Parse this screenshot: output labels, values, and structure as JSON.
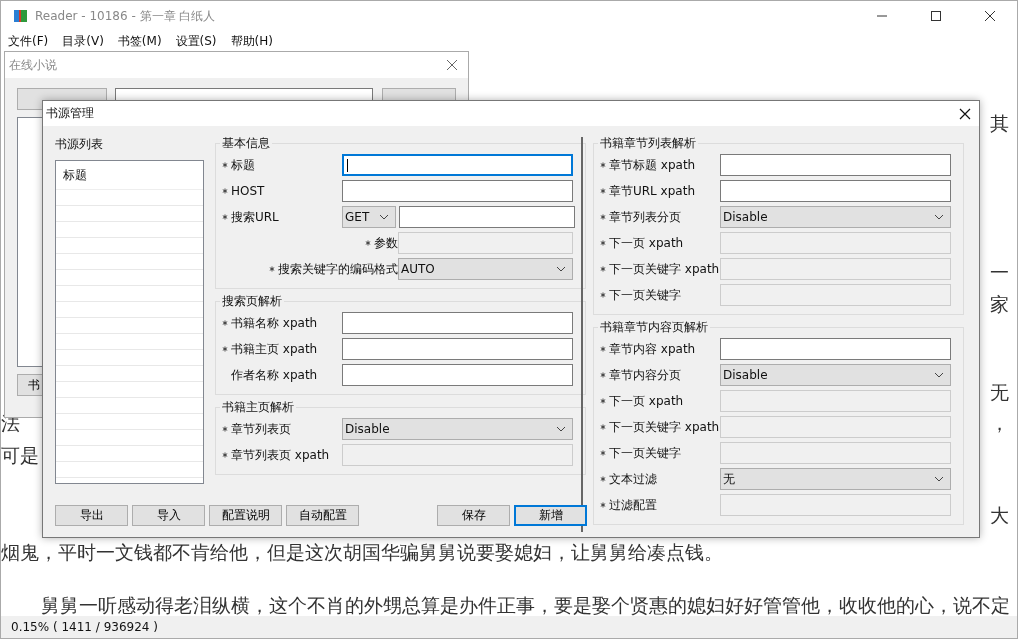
{
  "main_window": {
    "title": "Reader - 10186 - 第一章 白纸人",
    "menu": [
      "文件(F)",
      "目录(V)",
      "书签(M)",
      "设置(S)",
      "帮助(H)"
    ],
    "reader_text": [
      {
        "right": "其"
      },
      {
        "right": "一"
      },
      {
        "right": "家"
      },
      {
        "right": "无"
      },
      {
        "left": "法",
        "right": "，"
      },
      {
        "left": "可是"
      },
      {
        "right": "大"
      },
      {
        "left": "烟鬼，平时一文钱都不肯给他，但是这次胡国华骗舅舅说要娶媳妇，让舅舅给凑点钱。"
      },
      {
        "left": "舅舅一听感动得老泪纵横，这个不肖的外甥总算是办件正事，要是娶个贤惠的媳妇好好管管他，收收他的心，说不定"
      }
    ],
    "status": "0.15%  ( 1411 / 936924 )"
  },
  "online_window": {
    "title": "在线小说",
    "button": "书"
  },
  "dialog": {
    "title": "书源管理",
    "list_label": "书源列表",
    "list_column": "标题",
    "buttons": [
      {
        "label": "导出",
        "default": false
      },
      {
        "label": "导入",
        "default": false
      },
      {
        "label": "配置说明",
        "default": false
      },
      {
        "label": "自动配置",
        "default": false
      },
      {
        "label": "保存",
        "default": false
      },
      {
        "label": "新增",
        "default": true
      }
    ],
    "left_groups": [
      {
        "title": "基本信息",
        "fields": [
          {
            "label": "标题",
            "required": true,
            "kind": "text",
            "focused": true
          },
          {
            "label": "HOST",
            "required": true,
            "kind": "text",
            "focused": false
          },
          {
            "label": "搜索URL",
            "required": true,
            "kind": "method_url",
            "method": "GET"
          },
          {
            "label": "参数",
            "required": true,
            "kind": "param"
          },
          {
            "label": "搜索关键字的编码格式",
            "required": true,
            "kind": "encoding",
            "value": "AUTO"
          }
        ]
      },
      {
        "title": "搜索页解析",
        "fields": [
          {
            "label": "书籍名称 xpath",
            "required": true,
            "kind": "text",
            "focused": false
          },
          {
            "label": "书籍主页 xpath",
            "required": true,
            "kind": "text",
            "focused": false
          },
          {
            "label": "作者名称 xpath",
            "required": false,
            "kind": "text",
            "focused": false
          }
        ]
      },
      {
        "title": "书籍主页解析",
        "fields": [
          {
            "label": "章节列表页",
            "required": true,
            "kind": "select",
            "value": "Disable"
          },
          {
            "label": "章节列表页 xpath",
            "required": true,
            "kind": "disabled"
          }
        ]
      }
    ],
    "right_groups": [
      {
        "title": "书籍章节列表解析",
        "fields": [
          {
            "label": "章节标题 xpath",
            "required": true,
            "kind": "text",
            "focused": false
          },
          {
            "label": "章节URL  xpath",
            "required": true,
            "kind": "text",
            "focused": false
          },
          {
            "label": "章节列表分页",
            "required": true,
            "kind": "select",
            "value": "Disable"
          },
          {
            "label": "下一页 xpath",
            "required": true,
            "kind": "disabled"
          },
          {
            "label": "下一页关键字 xpath",
            "required": true,
            "kind": "disabled"
          },
          {
            "label": "下一页关键字",
            "required": true,
            "kind": "disabled"
          }
        ]
      },
      {
        "title": "书籍章节内容页解析",
        "fields": [
          {
            "label": "章节内容 xpath",
            "required": true,
            "kind": "text",
            "focused": false
          },
          {
            "label": "章节内容分页",
            "required": true,
            "kind": "select",
            "value": "Disable"
          },
          {
            "label": "下一页 xpath",
            "required": true,
            "kind": "disabled"
          },
          {
            "label": "下一页关键字 xpath",
            "required": true,
            "kind": "disabled"
          },
          {
            "label": "下一页关键字",
            "required": true,
            "kind": "disabled"
          },
          {
            "label": "文本过滤",
            "required": true,
            "kind": "select",
            "value": "无"
          },
          {
            "label": "过滤配置",
            "required": true,
            "kind": "disabled"
          }
        ]
      }
    ]
  }
}
